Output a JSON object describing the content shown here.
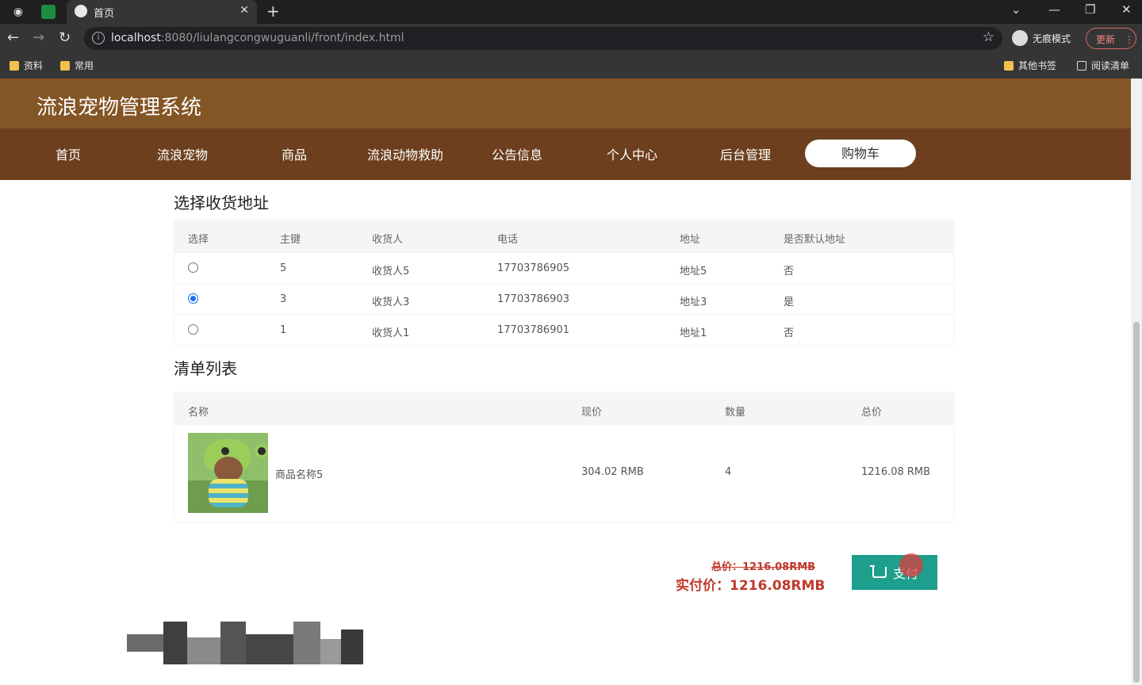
{
  "browser": {
    "tab_title": "首页",
    "url_host": "localhost",
    "url_rest": ":8080/liulangcongwuguanli/front/index.html",
    "incognito_label": "无痕模式",
    "update_label": "更新",
    "bookmarks": [
      "资料",
      "常用",
      "其他书签",
      "阅读清单"
    ]
  },
  "site": {
    "title": "流浪宠物管理系统",
    "nav": [
      "首页",
      "流浪宠物",
      "商品",
      "流浪动物救助",
      "公告信息",
      "个人中心",
      "后台管理",
      "购物车"
    ],
    "active_nav": "购物车"
  },
  "address_section": {
    "title": "选择收货地址",
    "columns": [
      "选择",
      "主键",
      "收货人",
      "电话",
      "地址",
      "是否默认地址"
    ],
    "rows": [
      {
        "selected": false,
        "id": "5",
        "name": "收货人5",
        "phone": "17703786905",
        "address": "地址5",
        "default": "否"
      },
      {
        "selected": true,
        "id": "3",
        "name": "收货人3",
        "phone": "17703786903",
        "address": "地址3",
        "default": "是"
      },
      {
        "selected": false,
        "id": "1",
        "name": "收货人1",
        "phone": "17703786901",
        "address": "地址1",
        "default": "否"
      }
    ]
  },
  "list_section": {
    "title": "清单列表",
    "columns": [
      "名称",
      "现价",
      "数量",
      "总价"
    ],
    "items": [
      {
        "name": "商品名称5",
        "price": "304.02 RMB",
        "qty": "4",
        "total": "1216.08 RMB"
      }
    ]
  },
  "summary": {
    "original_total": "总价：1216.08RMB",
    "actual_total": "实付价：1216.08RMB",
    "pay_label": "支付"
  },
  "colors": {
    "header": "#845525",
    "nav": "#6d3f1e",
    "pay_button": "#1e9e8c",
    "price_red": "#c0392b"
  }
}
